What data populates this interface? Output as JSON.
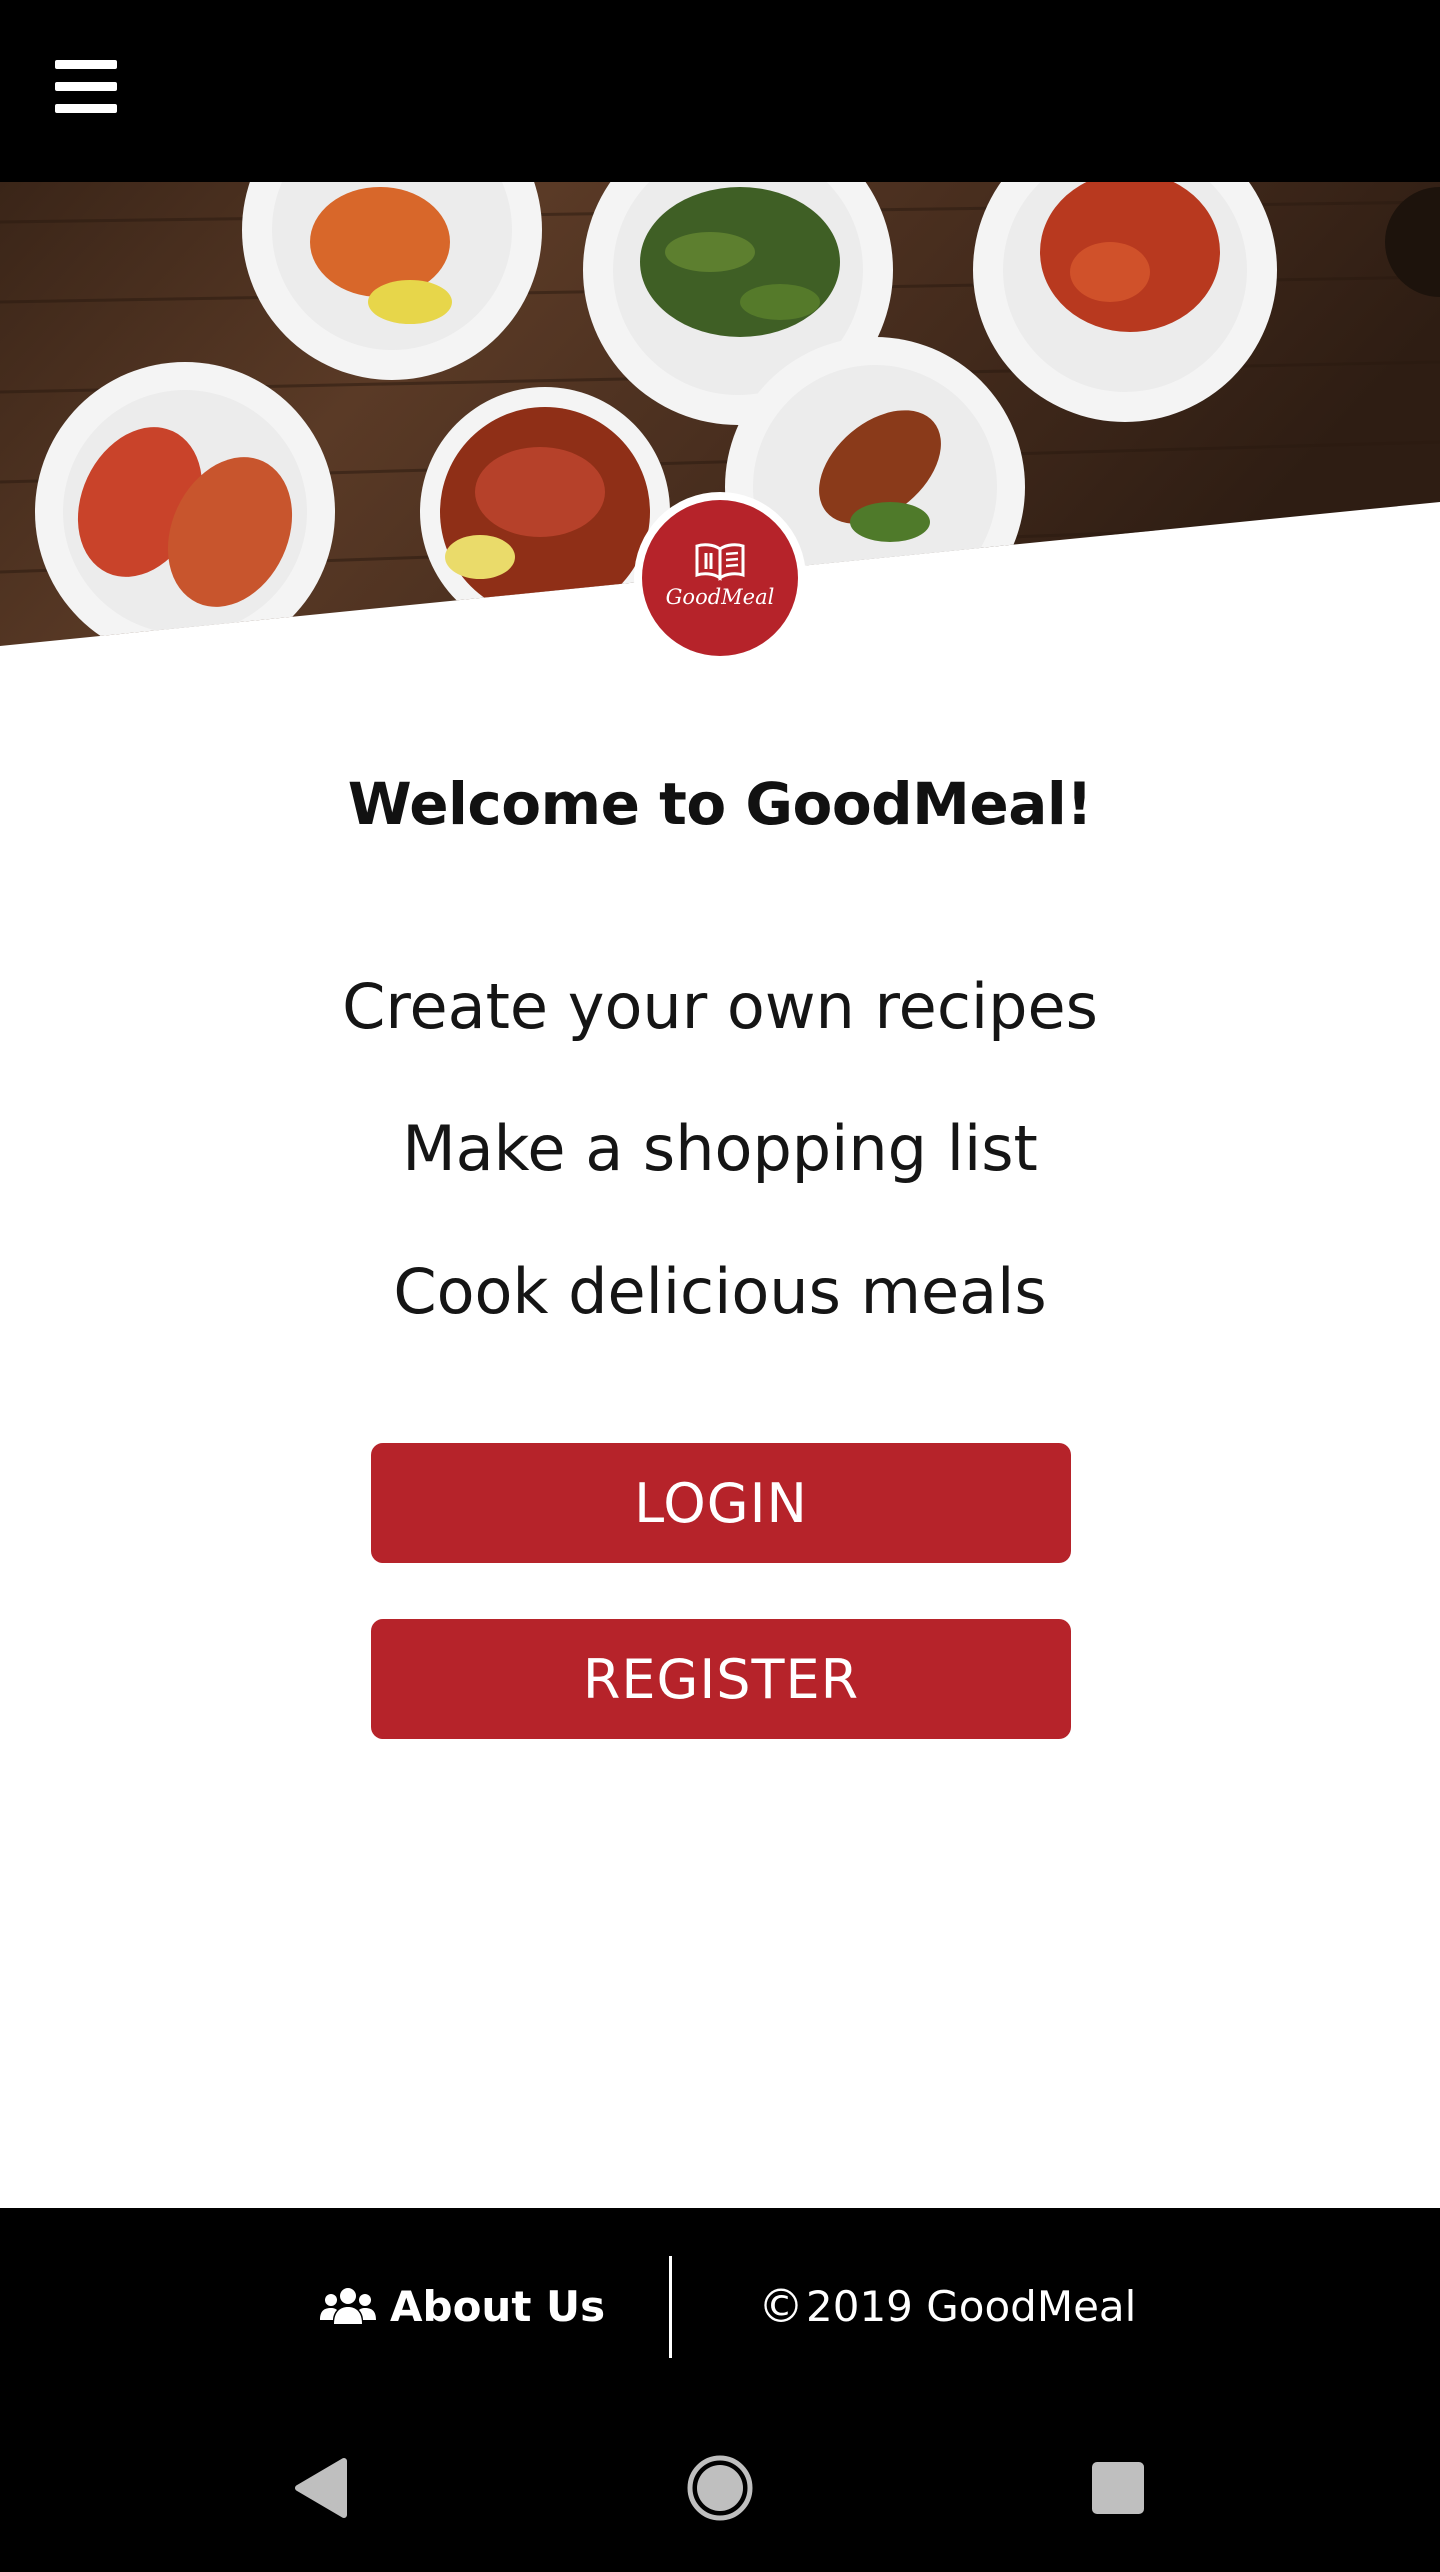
{
  "app": {
    "name": "GoodMeal",
    "logo_text": "GoodMeal"
  },
  "header": {
    "menu_icon": "hamburger-menu-icon"
  },
  "main": {
    "welcome": "Welcome to GoodMeal!",
    "features": [
      "Create your own recipes",
      "Make a shopping list",
      "Cook delicious meals"
    ],
    "login_label": "LOGIN",
    "register_label": "REGISTER"
  },
  "footer": {
    "about_icon": "users-icon",
    "about_label": "About Us",
    "copyright_symbol": "©",
    "copyright_text": "2019 GoodMeal"
  },
  "system_nav": {
    "back_icon": "back-triangle-icon",
    "home_icon": "home-circle-icon",
    "recents_icon": "recents-square-icon"
  },
  "colors": {
    "brand_red": "#b6232a",
    "bar_black": "#000000",
    "background": "#ffffff"
  }
}
